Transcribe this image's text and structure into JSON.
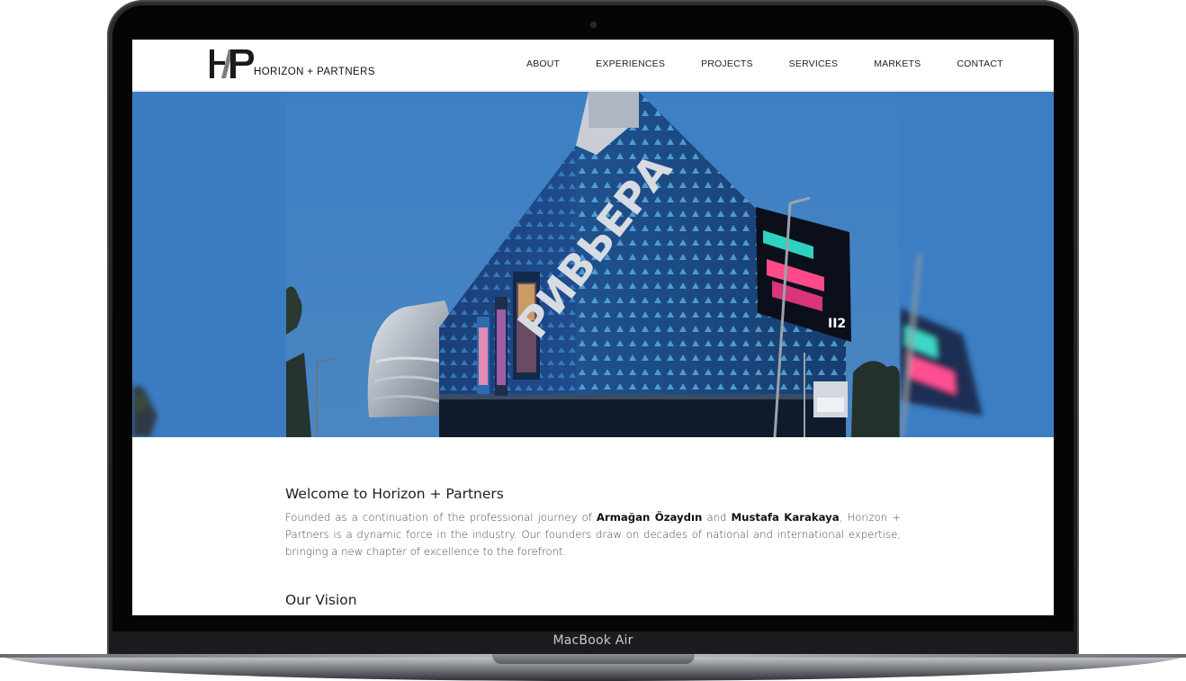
{
  "device": {
    "label": "MacBook Air"
  },
  "site": {
    "logo": {
      "mark": "HP",
      "text": "HORIZON + PARTNERS"
    },
    "nav": [
      {
        "label": "ABOUT"
      },
      {
        "label": "EXPERIENCES"
      },
      {
        "label": "PROJECTS"
      },
      {
        "label": "SERVICES"
      },
      {
        "label": "MARKETS"
      },
      {
        "label": "CONTACT"
      }
    ],
    "hero": {
      "building_sign": "РИВЬЕРА"
    },
    "welcome": {
      "title": "Welcome to Horizon + Partners",
      "text_before": "Founded as a continuation of the professional journey of ",
      "founder_1": "Armağan Özaydın",
      "text_and": " and ",
      "founder_2": "Mustafa Karakaya",
      "text_after": ", Horizon + Partners is a dynamic force in the industry. Our founders draw on decades of national and international expertise, bringing a new chapter of excellence to the forefront."
    },
    "vision": {
      "title": "Our Vision"
    }
  },
  "colors": {
    "sky": "#3e7fc1",
    "facade": "#1e4f92",
    "laptop_frame": "#1c1c1e",
    "text_dark": "#1f1f1f",
    "text_body": "#4a4a4a"
  }
}
